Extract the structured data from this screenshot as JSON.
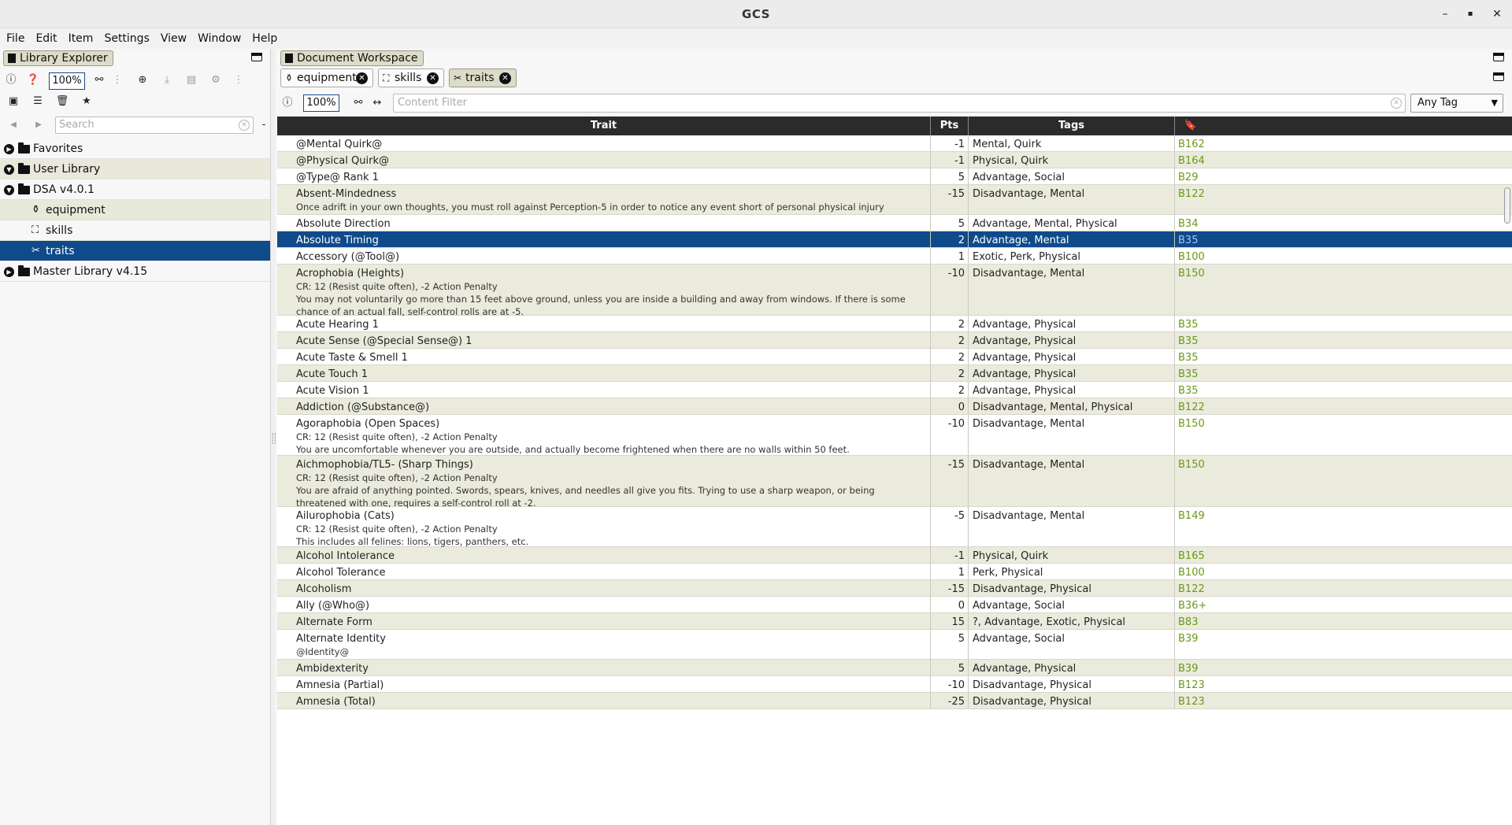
{
  "window": {
    "title": "GCS",
    "minimize": "–",
    "maximize": "▪",
    "close": "✕"
  },
  "menu": [
    "File",
    "Edit",
    "Item",
    "Settings",
    "View",
    "Window",
    "Help"
  ],
  "library": {
    "tab_label": "Library Explorer",
    "zoom": "100%",
    "search_placeholder": "Search",
    "tree": [
      {
        "label": "Favorites",
        "level": 0
      },
      {
        "label": "User Library",
        "level": 0
      },
      {
        "label": "DSA v4.0.1",
        "level": 0
      },
      {
        "label": "equipment",
        "level": 1,
        "icon": "equipment-icon"
      },
      {
        "label": "skills",
        "level": 1,
        "icon": "skills-icon"
      },
      {
        "label": "traits",
        "level": 1,
        "icon": "traits-icon",
        "selected": true
      },
      {
        "label": "Master Library v4.15",
        "level": 0
      }
    ]
  },
  "workspace": {
    "tab_label": "Document Workspace",
    "tabs": [
      {
        "label": "equipment",
        "active": false
      },
      {
        "label": "skills",
        "active": false
      },
      {
        "label": "traits",
        "active": true
      }
    ],
    "zoom": "100%",
    "filter_placeholder": "Content Filter",
    "tag_filter": "Any Tag"
  },
  "table": {
    "columns": [
      "Trait",
      "Pts",
      "Tags",
      "🔖"
    ],
    "rows": [
      {
        "name": "@Mental Quirk@",
        "notes": [],
        "pts": "-1",
        "tags": "Mental, Quirk",
        "ref": "B162"
      },
      {
        "name": "@Physical Quirk@",
        "notes": [],
        "pts": "-1",
        "tags": "Physical, Quirk",
        "ref": "B164"
      },
      {
        "name": "@Type@ Rank 1",
        "notes": [],
        "pts": "5",
        "tags": "Advantage, Social",
        "ref": "B29"
      },
      {
        "name": "Absent-Mindedness",
        "notes": [
          "Once adrift in your own thoughts, you must roll against Perception-5 in order to notice any event short of personal physical injury"
        ],
        "pts": "-15",
        "tags": "Disadvantage, Mental",
        "ref": "B122"
      },
      {
        "name": "Absolute Direction",
        "notes": [],
        "pts": "5",
        "tags": "Advantage, Mental, Physical",
        "ref": "B34"
      },
      {
        "name": "Absolute Timing",
        "notes": [],
        "pts": "2",
        "tags": "Advantage, Mental",
        "ref": "B35",
        "selected": true
      },
      {
        "name": "Accessory (@Tool@)",
        "notes": [],
        "pts": "1",
        "tags": "Exotic, Perk, Physical",
        "ref": "B100"
      },
      {
        "name": "Acrophobia (Heights)",
        "notes": [
          "CR: 12 (Resist quite often), -2 Action Penalty",
          "You may not voluntarily go more than 15 feet above ground, unless you are inside a building and away from windows. If there is some chance of an actual fall, self-control rolls are at -5."
        ],
        "pts": "-10",
        "tags": "Disadvantage, Mental",
        "ref": "B150"
      },
      {
        "name": "Acute Hearing 1",
        "notes": [],
        "pts": "2",
        "tags": "Advantage, Physical",
        "ref": "B35"
      },
      {
        "name": "Acute Sense (@Special Sense@) 1",
        "notes": [],
        "pts": "2",
        "tags": "Advantage, Physical",
        "ref": "B35"
      },
      {
        "name": "Acute Taste & Smell 1",
        "notes": [],
        "pts": "2",
        "tags": "Advantage, Physical",
        "ref": "B35"
      },
      {
        "name": "Acute Touch 1",
        "notes": [],
        "pts": "2",
        "tags": "Advantage, Physical",
        "ref": "B35"
      },
      {
        "name": "Acute Vision 1",
        "notes": [],
        "pts": "2",
        "tags": "Advantage, Physical",
        "ref": "B35"
      },
      {
        "name": "Addiction (@Substance@)",
        "notes": [],
        "pts": "0",
        "tags": "Disadvantage, Mental, Physical",
        "ref": "B122"
      },
      {
        "name": "Agoraphobia (Open Spaces)",
        "notes": [
          "CR: 12 (Resist quite often), -2 Action Penalty",
          "You are uncomfortable whenever you are outside, and actually become frightened when there are no walls within 50 feet."
        ],
        "pts": "-10",
        "tags": "Disadvantage, Mental",
        "ref": "B150"
      },
      {
        "name": "Aichmophobia/TL5- (Sharp Things)",
        "notes": [
          "CR: 12 (Resist quite often), -2 Action Penalty",
          "You are afraid of anything pointed. Swords, spears, knives, and needles all give you fits. Trying to use a sharp weapon, or being threatened with one, requires a self-control roll at -2."
        ],
        "pts": "-15",
        "tags": "Disadvantage, Mental",
        "ref": "B150"
      },
      {
        "name": "Ailurophobia (Cats)",
        "notes": [
          "CR: 12 (Resist quite often), -2 Action Penalty",
          "This includes all felines: lions, tigers, panthers, etc."
        ],
        "pts": "-5",
        "tags": "Disadvantage, Mental",
        "ref": "B149"
      },
      {
        "name": "Alcohol Intolerance",
        "notes": [],
        "pts": "-1",
        "tags": "Physical, Quirk",
        "ref": "B165"
      },
      {
        "name": "Alcohol Tolerance",
        "notes": [],
        "pts": "1",
        "tags": "Perk, Physical",
        "ref": "B100"
      },
      {
        "name": "Alcoholism",
        "notes": [],
        "pts": "-15",
        "tags": "Disadvantage, Physical",
        "ref": "B122"
      },
      {
        "name": "Ally (@Who@)",
        "notes": [],
        "pts": "0",
        "tags": "Advantage, Social",
        "ref": "B36+"
      },
      {
        "name": "Alternate Form",
        "notes": [],
        "pts": "15",
        "tags": "?, Advantage, Exotic, Physical",
        "ref": "B83"
      },
      {
        "name": "Alternate Identity",
        "notes": [
          "@Identity@"
        ],
        "pts": "5",
        "tags": "Advantage, Social",
        "ref": "B39"
      },
      {
        "name": "Ambidexterity",
        "notes": [],
        "pts": "5",
        "tags": "Advantage, Physical",
        "ref": "B39"
      },
      {
        "name": "Amnesia (Partial)",
        "notes": [],
        "pts": "-10",
        "tags": "Disadvantage, Physical",
        "ref": "B123"
      },
      {
        "name": "Amnesia (Total)",
        "notes": [],
        "pts": "-25",
        "tags": "Disadvantage, Physical",
        "ref": "B123"
      }
    ]
  }
}
